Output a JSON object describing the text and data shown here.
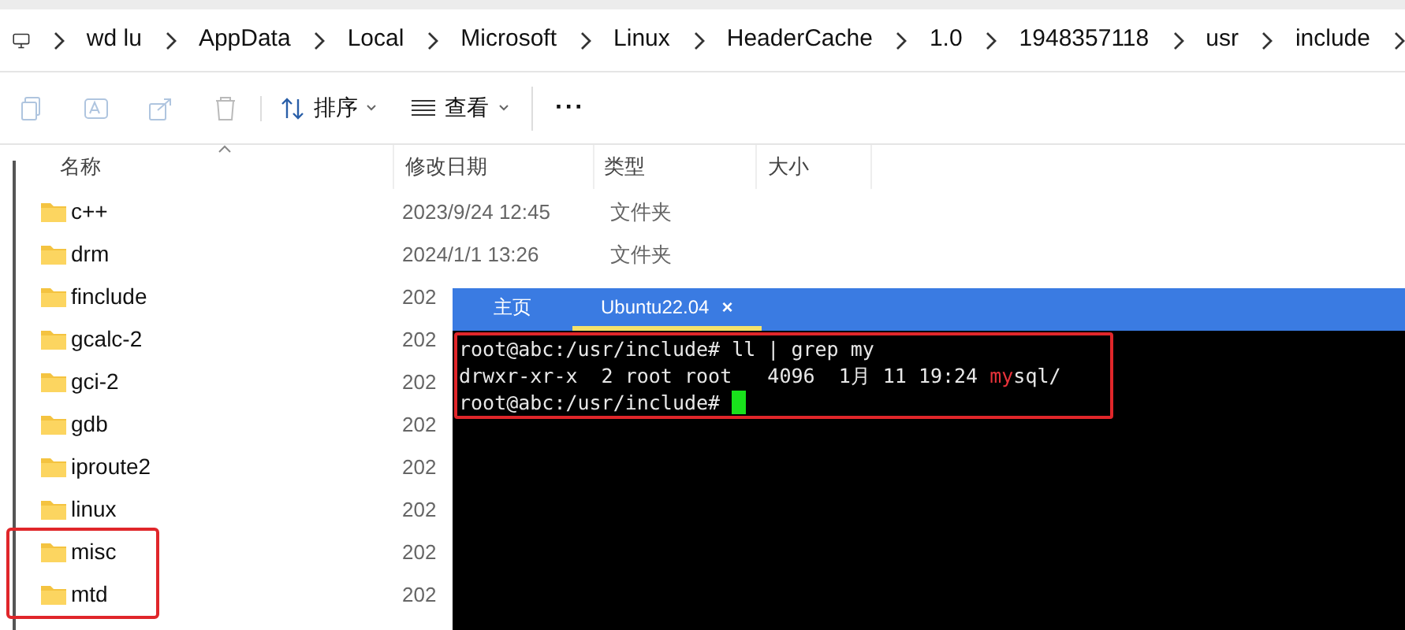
{
  "breadcrumb": [
    "wd lu",
    "AppData",
    "Local",
    "Microsoft",
    "Linux",
    "HeaderCache",
    "1.0",
    "1948357118",
    "usr",
    "include"
  ],
  "toolbar": {
    "sort": "排序",
    "view": "查看",
    "more": "···"
  },
  "table": {
    "columns": [
      "名称",
      "修改日期",
      "类型",
      "大小"
    ],
    "rows": [
      {
        "name": "c++",
        "date": "2023/9/24 12:45",
        "type": "文件夹",
        "highlighted": false
      },
      {
        "name": "drm",
        "date": "2024/1/1 13:26",
        "type": "文件夹",
        "highlighted": false
      },
      {
        "name": "finclude",
        "date": "202",
        "highlighted": false
      },
      {
        "name": "gcalc-2",
        "date": "202",
        "highlighted": false
      },
      {
        "name": "gci-2",
        "date": "202",
        "highlighted": false
      },
      {
        "name": "gdb",
        "date": "202",
        "highlighted": false
      },
      {
        "name": "iproute2",
        "date": "202",
        "highlighted": false
      },
      {
        "name": "linux",
        "date": "202",
        "highlighted": false
      },
      {
        "name": "misc",
        "date": "202",
        "highlighted": true
      },
      {
        "name": "mtd",
        "date": "202",
        "highlighted": true
      }
    ]
  },
  "terminal": {
    "tabs": [
      {
        "label": "主页",
        "selected": false,
        "closable": false
      },
      {
        "label": "Ubuntu22.04",
        "selected": true,
        "closable": true
      }
    ],
    "close_glyph": "×",
    "highlighted": true,
    "lines": [
      {
        "segments": [
          {
            "text": "root@abc:/usr/include# ll | grep my",
            "match": false
          }
        ],
        "cursor": false
      },
      {
        "segments": [
          {
            "text": "drwxr-xr-x  2 root root   4096  1月 11 19:24 ",
            "match": false
          },
          {
            "text": "my",
            "match": true
          },
          {
            "text": "sql/",
            "match": false
          }
        ],
        "cursor": false
      },
      {
        "segments": [
          {
            "text": "root@abc:/usr/include# ",
            "match": false
          }
        ],
        "cursor": true
      }
    ]
  }
}
